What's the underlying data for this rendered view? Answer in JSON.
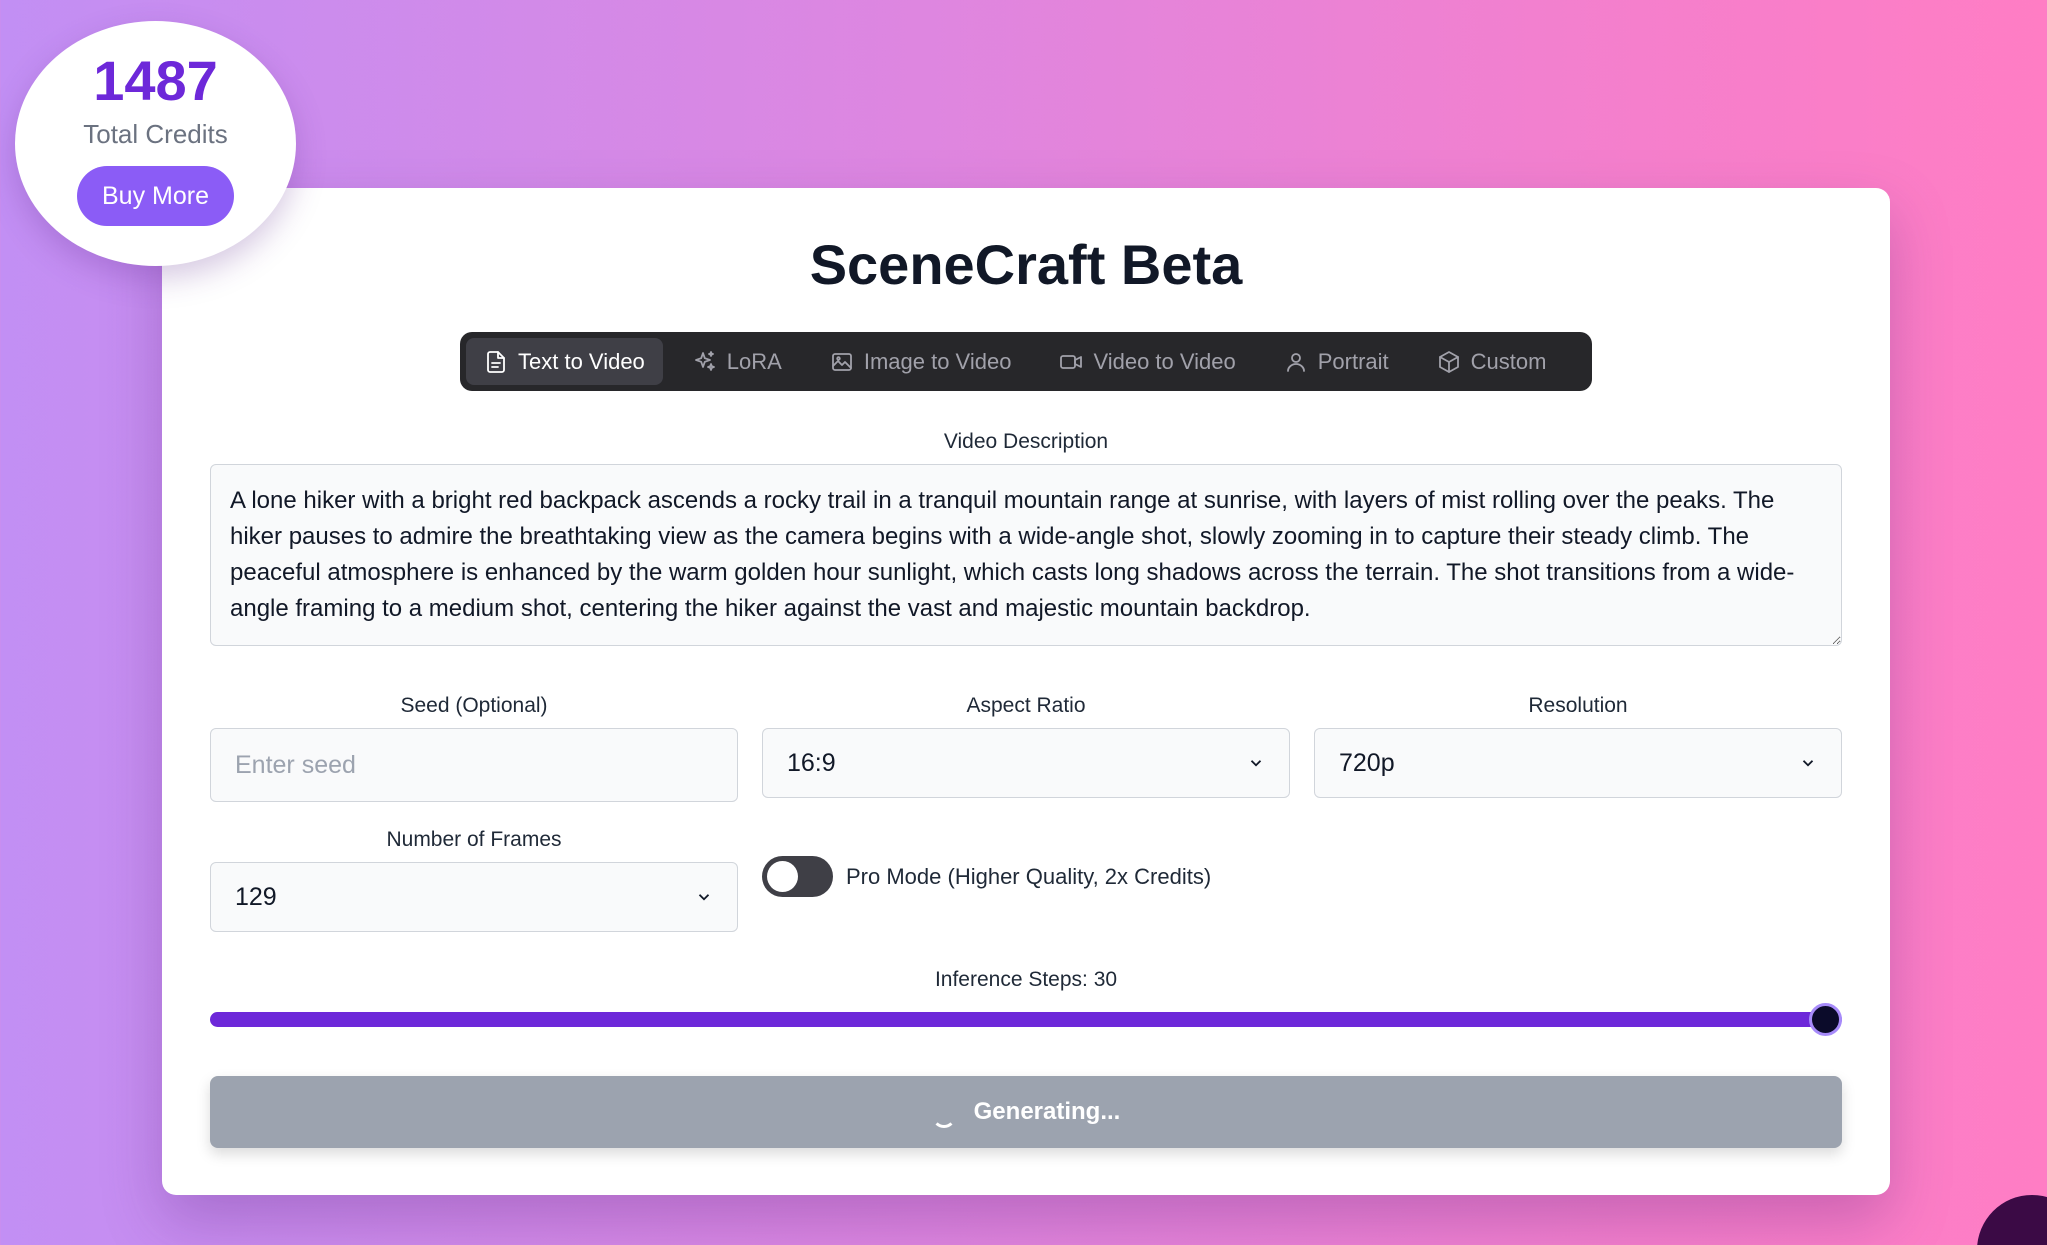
{
  "credits": {
    "count": "1487",
    "label": "Total Credits",
    "buy_label": "Buy More"
  },
  "app": {
    "title": "SceneCraft Beta"
  },
  "tabs": [
    {
      "label": "Text to Video",
      "icon": "file-text-icon",
      "active": true
    },
    {
      "label": "LoRA",
      "icon": "sparkles-icon",
      "active": false
    },
    {
      "label": "Image to Video",
      "icon": "image-icon",
      "active": false
    },
    {
      "label": "Video to Video",
      "icon": "video-camera-icon",
      "active": false
    },
    {
      "label": "Portrait",
      "icon": "user-icon",
      "active": false
    },
    {
      "label": "Custom",
      "icon": "cube-icon",
      "active": false
    }
  ],
  "description": {
    "label": "Video Description",
    "value": "A lone hiker with a bright red backpack ascends a rocky trail in a tranquil mountain range at sunrise, with layers of mist rolling over the peaks. The hiker pauses to admire the breathtaking view as the camera begins with a wide-angle shot, slowly zooming in to capture their steady climb. The peaceful atmosphere is enhanced by the warm golden hour sunlight, which casts long shadows across the terrain. The shot transitions from a wide-angle framing to a medium shot, centering the hiker against the vast and majestic mountain backdrop."
  },
  "seed": {
    "label": "Seed (Optional)",
    "placeholder": "Enter seed",
    "value": ""
  },
  "aspect_ratio": {
    "label": "Aspect Ratio",
    "value": "16:9"
  },
  "resolution": {
    "label": "Resolution",
    "value": "720p"
  },
  "frames": {
    "label": "Number of Frames",
    "value": "129"
  },
  "pro_mode": {
    "label": "Pro Mode (Higher Quality, 2x Credits)",
    "enabled": false
  },
  "inference": {
    "label": "Inference Steps: 30",
    "value": 30,
    "fraction": 1.0
  },
  "generate": {
    "label": "Generating..."
  },
  "colors": {
    "accent": "#6d28d9",
    "button": "#8b5cf6",
    "tab_bar": "#27272a",
    "disabled": "#9ca3af"
  }
}
